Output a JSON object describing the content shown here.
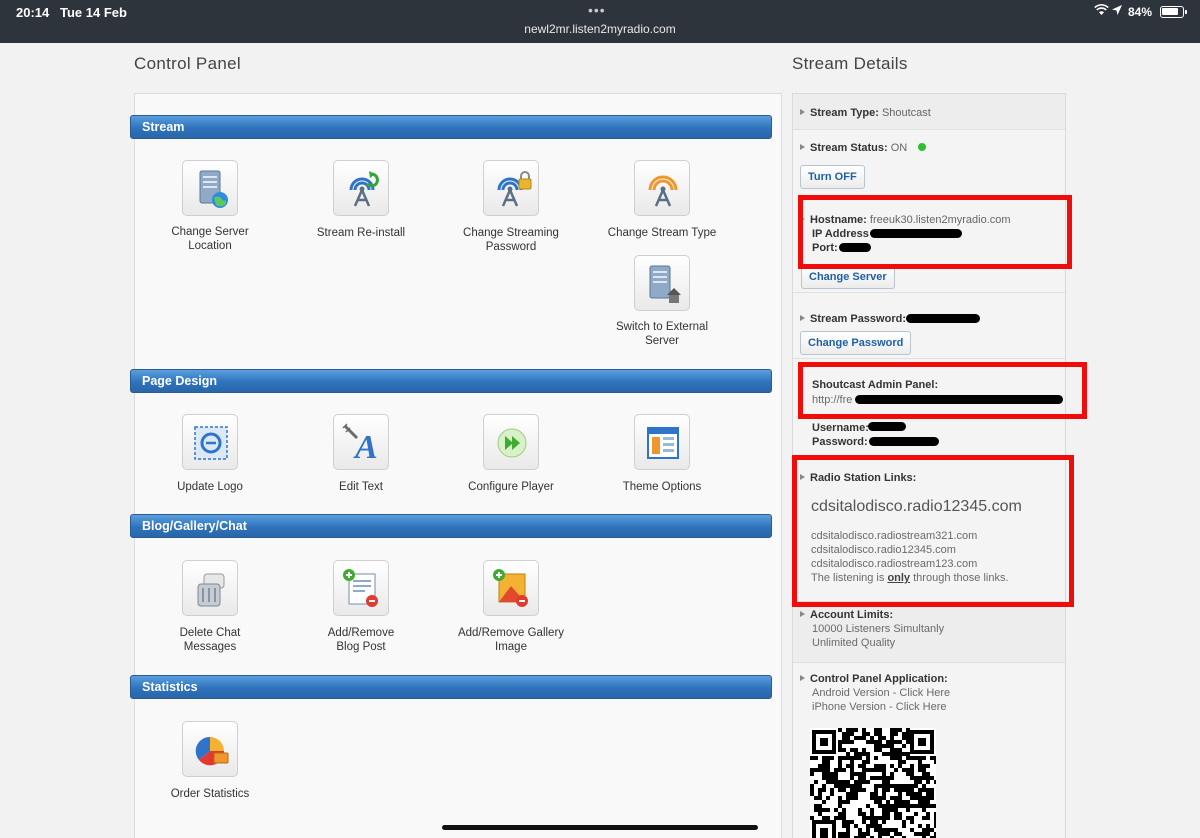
{
  "status_bar": {
    "time": "20:14",
    "date": "Tue 14 Feb",
    "url": "newl2mr.listen2myradio.com",
    "battery_percent_text": "84%",
    "battery_level": 0.84
  },
  "left": {
    "title": "Control Panel",
    "sections": {
      "stream": "Stream",
      "page_design": "Page Design",
      "blog": "Blog/Gallery/Chat",
      "statistics": "Statistics"
    },
    "tiles": {
      "change_server_location": "Change Server Location",
      "stream_reinstall": "Stream Re-install",
      "change_streaming_password": "Change Streaming Password",
      "change_stream_type": "Change Stream Type",
      "switch_external": "Switch to External Server",
      "update_logo": "Update Logo",
      "edit_text": "Edit Text",
      "configure_player": "Configure Player",
      "theme_options": "Theme Options",
      "delete_chat": "Delete Chat Messages",
      "add_remove_blog": "Add/Remove Blog Post",
      "add_remove_gallery": "Add/Remove Gallery Image",
      "order_statistics": "Order Statistics"
    }
  },
  "right": {
    "title": "Stream Details",
    "stream_type_label": "Stream Type:",
    "stream_type_value": "Shoutcast",
    "stream_status_label": "Stream Status:",
    "stream_status_value": "ON",
    "turn_off_button": "Turn OFF",
    "hostname_label": "Hostname:",
    "hostname_value": "freeuk30.listen2myradio.com",
    "ip_label": "IP Address",
    "port_label": "Port:",
    "change_server_button": "Change Server",
    "stream_password_label": "Stream Password:",
    "change_password_button": "Change Password",
    "admin_panel_label": "Shoutcast Admin Panel:",
    "admin_panel_url_prefix": "http://fre",
    "username_label": "Username:",
    "password_label": "Password:",
    "radio_links_label": "Radio Station Links:",
    "main_link": "cdsitalodisco.radio12345.com",
    "links": [
      "cdsitalodisco.radiostream321.com",
      "cdsitalodisco.radio12345.com",
      "cdsitalodisco.radiostream123.com"
    ],
    "listening_note_pre": "The listening is",
    "listening_note_em": "only",
    "listening_note_post": "through those links.",
    "account_limits_label": "Account Limits:",
    "limits": [
      "10000 Listeners Simultanly",
      "Unlimited Quality"
    ],
    "app_label": "Control Panel Application:",
    "android_link": "Android Version - Click Here",
    "iphone_link": "iPhone Version - Click Here"
  },
  "icons": [
    "wifi-icon",
    "location-icon",
    "battery-icon",
    "server-globe-icon",
    "antenna-refresh-icon",
    "antenna-lock-icon",
    "antenna-orange-icon",
    "server-house-icon",
    "logo-frame-icon",
    "edit-text-icon",
    "play-forward-icon",
    "theme-window-icon",
    "chat-bin-icon",
    "blog-add-remove-icon",
    "gallery-add-remove-icon",
    "pie-chart-icon",
    "qr-code-icon"
  ],
  "colors": {
    "section_bar": "#2f73bd",
    "link_button_text": "#1f5fa8",
    "status_on": "#2fbf2f",
    "annotation_red": "#f10c0c"
  }
}
